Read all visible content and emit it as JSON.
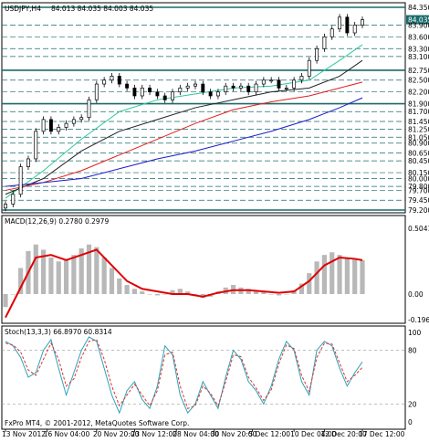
{
  "header": {
    "symbol": "USDJPY,H4",
    "quote": "84.013 84.035 84.003 84.035"
  },
  "footer": {
    "copyright": "FxPro MT4, © 2001-2012, MetaQuotes Software Corp."
  },
  "colors": {
    "background": "#ffffff",
    "frame": "#000000",
    "candle": "#000000",
    "horizontal_levels": "#1a6a6a",
    "ma_fast": "#2cc99a",
    "ma_medium": "#222222",
    "ma_red": "#e02020",
    "ma_blue": "#1a1acc",
    "macd_hist": "#b8b8b8",
    "macd_signal": "#e00000",
    "stoch_main": "#2aa3b8",
    "stoch_signal": "#e03030",
    "price_label_bg": "#1a6a6a"
  },
  "chart_data": [
    {
      "type": "line",
      "title": "USDJPY,H4",
      "subtitle": "84.013 84.035 84.003 84.035",
      "y_ticks": [
        "84.350",
        "84.035",
        "83.900",
        "83.600",
        "83.300",
        "83.100",
        "82.750",
        "82.500",
        "82.200",
        "81.900",
        "81.700",
        "81.450",
        "81.250",
        "81.050",
        "80.900",
        "80.650",
        "80.450",
        "80.150",
        "80.000",
        "79.800",
        "79.700",
        "79.450",
        "79.200"
      ],
      "ylim": [
        79.2,
        84.35
      ],
      "x_ticks": [
        "13 Nov 2012",
        "16 Nov 04:00",
        "20 Nov 20:00",
        "23 Nov 12:00",
        "28 Nov 04:00",
        "30 Nov 20:00",
        "5 Dec 12:00",
        "10 Dec 04:00",
        "12 Dec 20:00",
        "17 Dec 12:00"
      ],
      "horizontal_levels": [
        84.35,
        82.75,
        81.9,
        79.2
      ],
      "dashed_levels": [
        83.9,
        83.6,
        83.3,
        83.1,
        82.5,
        82.2,
        81.7,
        81.45,
        81.25,
        81.05,
        80.9,
        80.65,
        80.45,
        80.15,
        80.0,
        79.8,
        79.7,
        79.45
      ],
      "last_price": "84.035",
      "close_series": {
        "name": "",
        "x": [
          0,
          2,
          4,
          6,
          8,
          10,
          12,
          14,
          16,
          18,
          20,
          22,
          24,
          26,
          28,
          30,
          32,
          34,
          36,
          38,
          40,
          42,
          44,
          46,
          48,
          50,
          52,
          54,
          56,
          58,
          60,
          62,
          64,
          66,
          68,
          70,
          72,
          74,
          76,
          78,
          80,
          82,
          84,
          86,
          88,
          90,
          92,
          94
        ],
        "values": [
          79.35,
          79.6,
          80.3,
          80.5,
          81.2,
          81.5,
          81.2,
          81.3,
          81.4,
          81.5,
          81.55,
          82.0,
          82.4,
          82.5,
          82.6,
          82.4,
          82.3,
          82.1,
          82.3,
          82.2,
          82.1,
          82.0,
          82.2,
          82.3,
          82.35,
          82.4,
          82.2,
          82.1,
          82.2,
          82.35,
          82.3,
          82.35,
          82.2,
          82.4,
          82.5,
          82.5,
          82.3,
          82.3,
          82.5,
          82.6,
          83.0,
          83.3,
          83.6,
          83.8,
          84.1,
          83.7,
          83.9,
          84.035
        ]
      },
      "moving_averages": [
        {
          "name": "",
          "x": [
            0,
            10,
            20,
            30,
            40,
            50,
            60,
            70,
            80,
            88,
            94
          ],
          "values": [
            79.5,
            80.2,
            81.0,
            81.7,
            82.0,
            82.15,
            82.3,
            82.35,
            82.5,
            83.0,
            83.4
          ]
        },
        {
          "name": "",
          "x": [
            0,
            10,
            20,
            30,
            40,
            50,
            60,
            70,
            80,
            88,
            94
          ],
          "values": [
            79.6,
            80.0,
            80.7,
            81.2,
            81.5,
            81.8,
            82.0,
            82.2,
            82.3,
            82.6,
            83.0
          ]
        },
        {
          "name": "",
          "x": [
            0,
            10,
            20,
            30,
            40,
            50,
            60,
            70,
            80,
            88,
            94
          ],
          "values": [
            79.7,
            79.9,
            80.2,
            80.6,
            81.0,
            81.4,
            81.75,
            81.95,
            82.1,
            82.3,
            82.45
          ]
        },
        {
          "name": "",
          "x": [
            0,
            10,
            20,
            30,
            40,
            50,
            60,
            70,
            80,
            88,
            94
          ],
          "values": [
            79.8,
            79.9,
            80.0,
            80.25,
            80.5,
            80.7,
            80.95,
            81.2,
            81.5,
            81.8,
            82.05
          ]
        }
      ]
    },
    {
      "type": "bar",
      "title": "MACD(12,26,9) 0.2780 0.2979",
      "y_ticks": [
        "0.5041",
        "0.00",
        "-0.196"
      ],
      "ylim": [
        -0.196,
        0.5041
      ],
      "x": [
        0,
        2,
        4,
        6,
        8,
        10,
        12,
        14,
        16,
        18,
        20,
        22,
        24,
        26,
        28,
        30,
        32,
        34,
        36,
        38,
        40,
        42,
        44,
        46,
        48,
        50,
        52,
        54,
        56,
        58,
        60,
        62,
        64,
        66,
        68,
        70,
        72,
        74,
        76,
        78,
        80,
        82,
        84,
        86,
        88,
        90,
        92,
        94
      ],
      "histogram": [
        -0.1,
        0.0,
        0.2,
        0.33,
        0.38,
        0.34,
        0.28,
        0.25,
        0.26,
        0.3,
        0.35,
        0.38,
        0.36,
        0.28,
        0.2,
        0.12,
        0.07,
        0.04,
        0.02,
        0.0,
        -0.01,
        0.0,
        0.03,
        0.04,
        0.02,
        0.0,
        -0.03,
        -0.02,
        0.02,
        0.05,
        0.07,
        0.05,
        0.04,
        0.02,
        0.02,
        0.0,
        -0.01,
        0.0,
        0.03,
        0.08,
        0.16,
        0.25,
        0.3,
        0.32,
        0.3,
        0.28,
        0.27,
        0.26
      ],
      "signal_line": {
        "name": "",
        "x": [
          0,
          4,
          8,
          12,
          16,
          20,
          24,
          28,
          32,
          36,
          40,
          44,
          48,
          52,
          56,
          60,
          64,
          68,
          72,
          76,
          80,
          84,
          88,
          92,
          94
        ],
        "values": [
          -0.18,
          0.05,
          0.28,
          0.3,
          0.26,
          0.3,
          0.34,
          0.22,
          0.1,
          0.04,
          0.02,
          0.0,
          0.0,
          -0.02,
          0.01,
          0.03,
          0.03,
          0.02,
          0.01,
          0.02,
          0.1,
          0.22,
          0.28,
          0.27,
          0.26
        ]
      }
    },
    {
      "type": "line",
      "title": "Stoch(13,3,3) 66.8970 60.8314",
      "y_ticks": [
        "100",
        "80",
        "20",
        "0"
      ],
      "ylim": [
        0,
        100
      ],
      "x": [
        0,
        2,
        4,
        6,
        8,
        10,
        12,
        14,
        16,
        18,
        20,
        22,
        24,
        26,
        28,
        30,
        32,
        34,
        36,
        38,
        40,
        42,
        44,
        46,
        48,
        50,
        52,
        54,
        56,
        58,
        60,
        62,
        64,
        66,
        68,
        70,
        72,
        74,
        76,
        78,
        80,
        82,
        84,
        86,
        88,
        90,
        92,
        94
      ],
      "series": [
        {
          "name": "",
          "values": [
            90,
            85,
            72,
            50,
            55,
            80,
            92,
            60,
            30,
            55,
            80,
            95,
            90,
            60,
            30,
            10,
            35,
            45,
            25,
            15,
            40,
            85,
            75,
            30,
            10,
            20,
            45,
            30,
            15,
            50,
            80,
            70,
            45,
            35,
            20,
            40,
            70,
            90,
            80,
            45,
            30,
            80,
            90,
            85,
            60,
            40,
            55,
            67
          ]
        },
        {
          "name": "",
          "values": [
            88,
            86,
            78,
            58,
            52,
            70,
            88,
            70,
            40,
            48,
            72,
            90,
            92,
            70,
            40,
            18,
            30,
            42,
            30,
            18,
            35,
            75,
            78,
            40,
            15,
            18,
            40,
            32,
            18,
            45,
            75,
            73,
            50,
            38,
            24,
            36,
            65,
            86,
            82,
            52,
            34,
            72,
            88,
            87,
            66,
            45,
            52,
            61
          ]
        }
      ]
    }
  ]
}
